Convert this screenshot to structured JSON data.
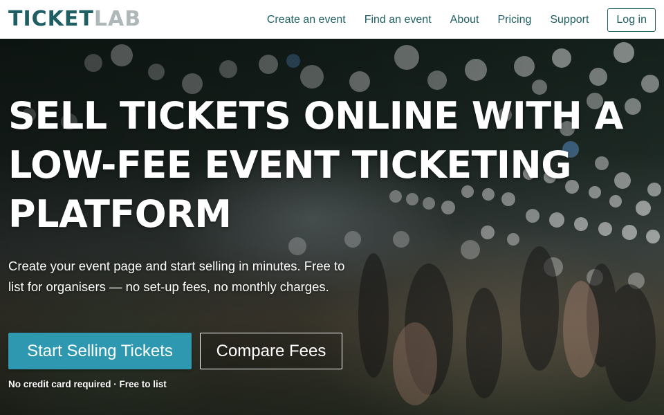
{
  "brand": {
    "logo_part1": "TICKET",
    "logo_part2": "LAB",
    "primary_color": "#1f5f63",
    "secondary_color": "#aeb8b8"
  },
  "nav": {
    "items": [
      "Create an event",
      "Find an event",
      "About",
      "Pricing",
      "Support"
    ],
    "login_label": "Log in"
  },
  "hero": {
    "headline": "SELL TICKETS ONLINE WITH A LOW-FEE EVENT TICKETING PLATFORM",
    "subtext": "Create your event page and start selling in minutes. Free to list for organisers — no set-up fees, no monthly charges.",
    "primary_cta": "Start Selling Tickets",
    "secondary_cta": "Compare Fees",
    "note": "No credit card required · Free to list",
    "cta_color": "#2e98b0"
  }
}
